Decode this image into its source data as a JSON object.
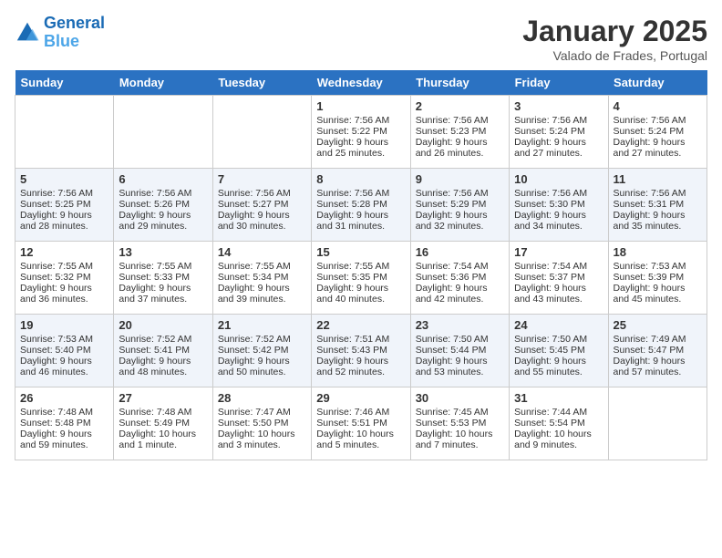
{
  "header": {
    "logo_line1": "General",
    "logo_line2": "Blue",
    "month": "January 2025",
    "location": "Valado de Frades, Portugal"
  },
  "weekdays": [
    "Sunday",
    "Monday",
    "Tuesday",
    "Wednesday",
    "Thursday",
    "Friday",
    "Saturday"
  ],
  "weeks": [
    [
      {
        "day": "",
        "empty": true
      },
      {
        "day": "",
        "empty": true
      },
      {
        "day": "",
        "empty": true
      },
      {
        "day": "1",
        "sunrise": "7:56 AM",
        "sunset": "5:22 PM",
        "daylight": "9 hours and 25 minutes."
      },
      {
        "day": "2",
        "sunrise": "7:56 AM",
        "sunset": "5:23 PM",
        "daylight": "9 hours and 26 minutes."
      },
      {
        "day": "3",
        "sunrise": "7:56 AM",
        "sunset": "5:24 PM",
        "daylight": "9 hours and 27 minutes."
      },
      {
        "day": "4",
        "sunrise": "7:56 AM",
        "sunset": "5:24 PM",
        "daylight": "9 hours and 27 minutes."
      }
    ],
    [
      {
        "day": "5",
        "sunrise": "7:56 AM",
        "sunset": "5:25 PM",
        "daylight": "9 hours and 28 minutes."
      },
      {
        "day": "6",
        "sunrise": "7:56 AM",
        "sunset": "5:26 PM",
        "daylight": "9 hours and 29 minutes."
      },
      {
        "day": "7",
        "sunrise": "7:56 AM",
        "sunset": "5:27 PM",
        "daylight": "9 hours and 30 minutes."
      },
      {
        "day": "8",
        "sunrise": "7:56 AM",
        "sunset": "5:28 PM",
        "daylight": "9 hours and 31 minutes."
      },
      {
        "day": "9",
        "sunrise": "7:56 AM",
        "sunset": "5:29 PM",
        "daylight": "9 hours and 32 minutes."
      },
      {
        "day": "10",
        "sunrise": "7:56 AM",
        "sunset": "5:30 PM",
        "daylight": "9 hours and 34 minutes."
      },
      {
        "day": "11",
        "sunrise": "7:56 AM",
        "sunset": "5:31 PM",
        "daylight": "9 hours and 35 minutes."
      }
    ],
    [
      {
        "day": "12",
        "sunrise": "7:55 AM",
        "sunset": "5:32 PM",
        "daylight": "9 hours and 36 minutes."
      },
      {
        "day": "13",
        "sunrise": "7:55 AM",
        "sunset": "5:33 PM",
        "daylight": "9 hours and 37 minutes."
      },
      {
        "day": "14",
        "sunrise": "7:55 AM",
        "sunset": "5:34 PM",
        "daylight": "9 hours and 39 minutes."
      },
      {
        "day": "15",
        "sunrise": "7:55 AM",
        "sunset": "5:35 PM",
        "daylight": "9 hours and 40 minutes."
      },
      {
        "day": "16",
        "sunrise": "7:54 AM",
        "sunset": "5:36 PM",
        "daylight": "9 hours and 42 minutes."
      },
      {
        "day": "17",
        "sunrise": "7:54 AM",
        "sunset": "5:37 PM",
        "daylight": "9 hours and 43 minutes."
      },
      {
        "day": "18",
        "sunrise": "7:53 AM",
        "sunset": "5:39 PM",
        "daylight": "9 hours and 45 minutes."
      }
    ],
    [
      {
        "day": "19",
        "sunrise": "7:53 AM",
        "sunset": "5:40 PM",
        "daylight": "9 hours and 46 minutes."
      },
      {
        "day": "20",
        "sunrise": "7:52 AM",
        "sunset": "5:41 PM",
        "daylight": "9 hours and 48 minutes."
      },
      {
        "day": "21",
        "sunrise": "7:52 AM",
        "sunset": "5:42 PM",
        "daylight": "9 hours and 50 minutes."
      },
      {
        "day": "22",
        "sunrise": "7:51 AM",
        "sunset": "5:43 PM",
        "daylight": "9 hours and 52 minutes."
      },
      {
        "day": "23",
        "sunrise": "7:50 AM",
        "sunset": "5:44 PM",
        "daylight": "9 hours and 53 minutes."
      },
      {
        "day": "24",
        "sunrise": "7:50 AM",
        "sunset": "5:45 PM",
        "daylight": "9 hours and 55 minutes."
      },
      {
        "day": "25",
        "sunrise": "7:49 AM",
        "sunset": "5:47 PM",
        "daylight": "9 hours and 57 minutes."
      }
    ],
    [
      {
        "day": "26",
        "sunrise": "7:48 AM",
        "sunset": "5:48 PM",
        "daylight": "9 hours and 59 minutes."
      },
      {
        "day": "27",
        "sunrise": "7:48 AM",
        "sunset": "5:49 PM",
        "daylight": "10 hours and 1 minute."
      },
      {
        "day": "28",
        "sunrise": "7:47 AM",
        "sunset": "5:50 PM",
        "daylight": "10 hours and 3 minutes."
      },
      {
        "day": "29",
        "sunrise": "7:46 AM",
        "sunset": "5:51 PM",
        "daylight": "10 hours and 5 minutes."
      },
      {
        "day": "30",
        "sunrise": "7:45 AM",
        "sunset": "5:53 PM",
        "daylight": "10 hours and 7 minutes."
      },
      {
        "day": "31",
        "sunrise": "7:44 AM",
        "sunset": "5:54 PM",
        "daylight": "10 hours and 9 minutes."
      },
      {
        "day": "",
        "empty": true
      }
    ]
  ]
}
